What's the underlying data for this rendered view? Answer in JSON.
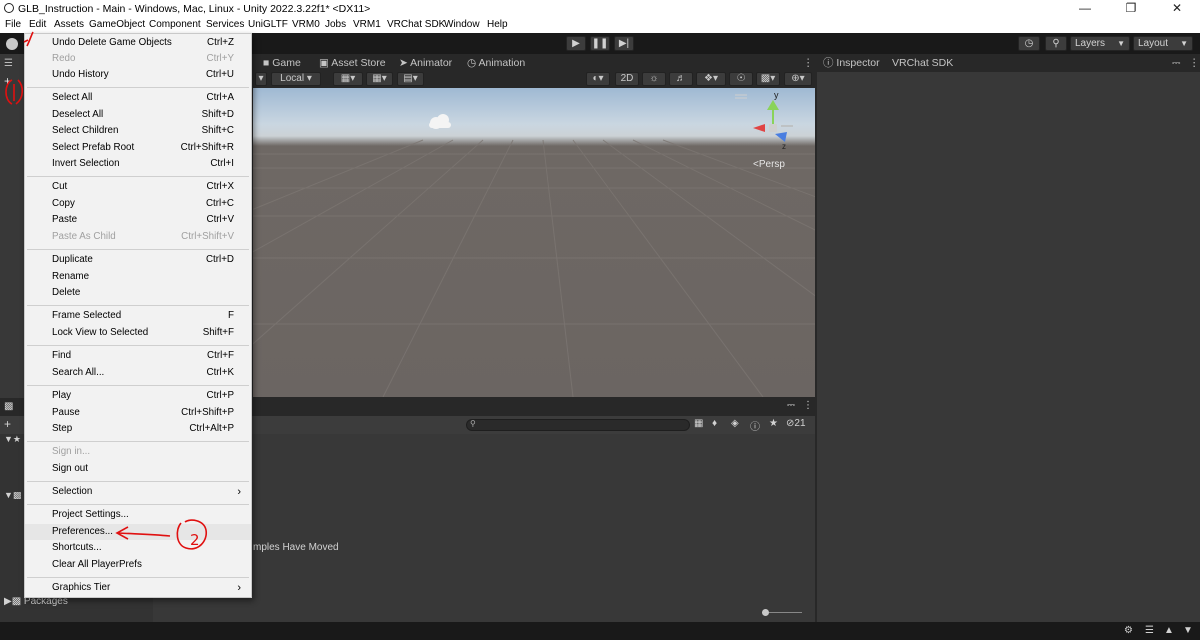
{
  "window": {
    "title": "GLB_Instruction - Main - Windows, Mac, Linux - Unity 2022.3.22f1* <DX11>"
  },
  "menubar": {
    "items": [
      "File",
      "Edit",
      "Assets",
      "GameObject",
      "Component",
      "Services",
      "UniGLTF",
      "VRM0",
      "Jobs",
      "VRM1",
      "VRChat SDK",
      "Window",
      "Help"
    ]
  },
  "toolbar": {
    "layers_label": "Layers",
    "layout_label": "Layout"
  },
  "tabs": {
    "game": "Game",
    "asset_store": "Asset Store",
    "animator": "Animator",
    "animation": "Animation",
    "inspector": "Inspector",
    "vrchat_sdk": "VRChat SDK"
  },
  "scene": {
    "pivot_label": "Local",
    "mode_2d": "2D",
    "persp_label": "Persp",
    "gizmo_y": "y",
    "gizmo_z": "z"
  },
  "project": {
    "hidden_count": "21",
    "packages_label": "Packages",
    "message_fragment": "mples Have Moved"
  },
  "edit_menu": {
    "items": [
      {
        "label": "Undo Delete Game Objects",
        "shortcut": "Ctrl+Z"
      },
      {
        "label": "Redo",
        "shortcut": "Ctrl+Y"
      },
      {
        "label": "Undo History",
        "shortcut": "Ctrl+U"
      },
      {
        "label": "Select All",
        "shortcut": "Ctrl+A"
      },
      {
        "label": "Deselect All",
        "shortcut": "Shift+D"
      },
      {
        "label": "Select Children",
        "shortcut": "Shift+C"
      },
      {
        "label": "Select Prefab Root",
        "shortcut": "Ctrl+Shift+R"
      },
      {
        "label": "Invert Selection",
        "shortcut": "Ctrl+I"
      },
      {
        "label": "Cut",
        "shortcut": "Ctrl+X"
      },
      {
        "label": "Copy",
        "shortcut": "Ctrl+C"
      },
      {
        "label": "Paste",
        "shortcut": "Ctrl+V"
      },
      {
        "label": "Paste As Child",
        "shortcut": "Ctrl+Shift+V"
      },
      {
        "label": "Duplicate",
        "shortcut": "Ctrl+D"
      },
      {
        "label": "Rename",
        "shortcut": ""
      },
      {
        "label": "Delete",
        "shortcut": ""
      },
      {
        "label": "Frame Selected",
        "shortcut": "F"
      },
      {
        "label": "Lock View to Selected",
        "shortcut": "Shift+F"
      },
      {
        "label": "Find",
        "shortcut": "Ctrl+F"
      },
      {
        "label": "Search All...",
        "shortcut": "Ctrl+K"
      },
      {
        "label": "Play",
        "shortcut": "Ctrl+P"
      },
      {
        "label": "Pause",
        "shortcut": "Ctrl+Shift+P"
      },
      {
        "label": "Step",
        "shortcut": "Ctrl+Alt+P"
      },
      {
        "label": "Sign in...",
        "shortcut": ""
      },
      {
        "label": "Sign out",
        "shortcut": ""
      },
      {
        "label": "Selection",
        "shortcut": ""
      },
      {
        "label": "Project Settings...",
        "shortcut": ""
      },
      {
        "label": "Preferences...",
        "shortcut": ""
      },
      {
        "label": "Shortcuts...",
        "shortcut": ""
      },
      {
        "label": "Clear All PlayerPrefs",
        "shortcut": ""
      },
      {
        "label": "Graphics Tier",
        "shortcut": ""
      }
    ]
  },
  "annotations": {
    "step_two": "2"
  }
}
